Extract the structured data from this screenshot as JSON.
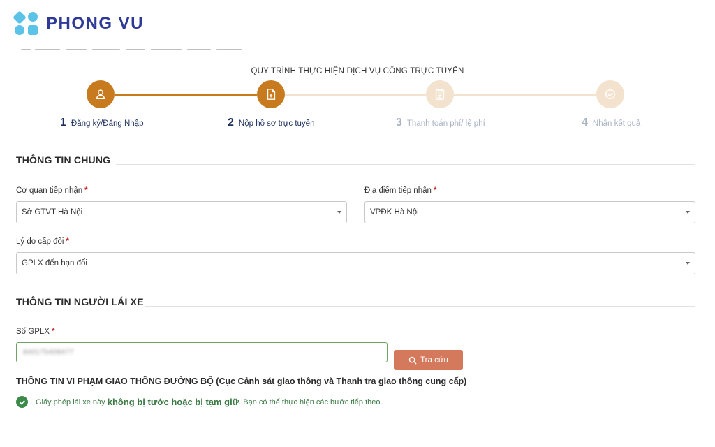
{
  "brand": {
    "name": "PHONG VU"
  },
  "steps": {
    "title": "QUY TRÌNH THỰC HIỆN DỊCH VỤ CÔNG TRỰC TUYẾN",
    "items": [
      {
        "num": "1",
        "label": "Đăng ký/Đăng Nhập",
        "state": "done",
        "icon": "user-icon"
      },
      {
        "num": "2",
        "label": "Nộp hồ sơ trực tuyến",
        "state": "active",
        "icon": "document-icon"
      },
      {
        "num": "3",
        "label": "Thanh toán phí/ lệ phí",
        "state": "inactive",
        "icon": "clipboard-icon"
      },
      {
        "num": "4",
        "label": "Nhận kết quả",
        "state": "inactive",
        "icon": "check-circle-icon"
      }
    ]
  },
  "general": {
    "title": "THÔNG TIN CHUNG",
    "agency": {
      "label": "Cơ quan tiếp nhận",
      "required": "*",
      "value": "Sở GTVT Hà Nội"
    },
    "location": {
      "label": "Địa điểm tiếp nhận",
      "required": "*",
      "value": "VPĐK Hà Nội"
    },
    "reason": {
      "label": "Lý do cấp đổi",
      "required": "*",
      "value": "GPLX đến hạn đổi"
    }
  },
  "driver": {
    "title": "THÔNG TIN NGƯỜI LÁI XE",
    "license": {
      "label": "Số GPLX",
      "required": "*",
      "value": "840175408477"
    },
    "search_label": "Tra cứu"
  },
  "violation": {
    "title": "THÔNG TIN VI PHẠM GIAO THÔNG ĐƯỜNG BỘ (Cục Cảnh sát giao thông và Thanh tra giao thông cung cấp)",
    "result_pre": "Giấy phép lái xe này ",
    "result_strong": "không bị tước hoặc bị tạm giữ",
    "result_post": ". Bạn có thể thực hiện các bước tiếp theo."
  },
  "colors": {
    "brand_blue": "#2e3a97",
    "brand_cyan": "#5bc3e8",
    "step_active": "#c77a1e",
    "step_inactive": "#f3e2cd",
    "button": "#d4795b",
    "success": "#3c8a4a"
  }
}
